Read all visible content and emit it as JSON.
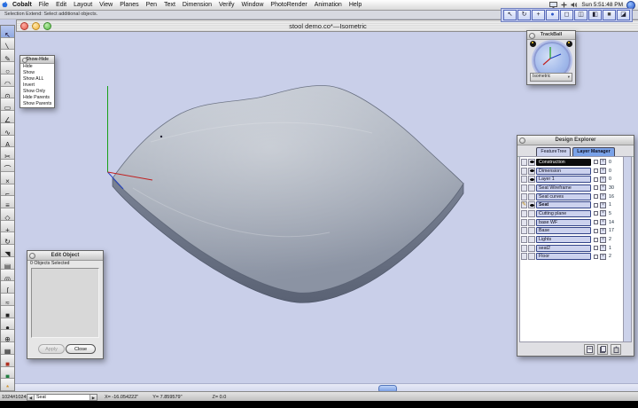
{
  "menu_bar": {
    "app_name": "Cobalt",
    "menus": [
      "File",
      "Edit",
      "Layout",
      "View",
      "Planes",
      "Pen",
      "Text",
      "Dimension",
      "Verify",
      "Window",
      "PhotoRender",
      "Animation",
      "Help"
    ],
    "extras": {
      "icons": [
        "displays-icon",
        "plus-icon",
        "volume-icon",
        "app-switcher-icon"
      ],
      "clock": "Sun 5:51:48 PM"
    }
  },
  "message_line": "Selection Extend: Select additional objects.",
  "window": {
    "title": "stool demo.co*—Isometric"
  },
  "view_toolbar": {
    "buttons": [
      {
        "name": "select-mode-button",
        "glyph": "↖"
      },
      {
        "name": "orbit-view-button",
        "glyph": "↻"
      },
      {
        "name": "pan-view-button",
        "glyph": "+"
      },
      {
        "name": "zoom-sphere-button",
        "glyph": "●",
        "color": "#2a56c8"
      },
      {
        "name": "wireframe-view-button",
        "glyph": "◻"
      },
      {
        "name": "hiddenline-view-button",
        "glyph": "◫"
      },
      {
        "name": "shaded-view-button",
        "glyph": "◧"
      },
      {
        "name": "rendered-view-button",
        "glyph": "■",
        "color": "#444444"
      },
      {
        "name": "view-options-button",
        "glyph": "◪"
      }
    ]
  },
  "tool_palette": {
    "tools": [
      {
        "name": "select-arrow-tool",
        "glyph": "↖",
        "selected": true
      },
      {
        "name": "line-tool",
        "glyph": "╲"
      },
      {
        "name": "pen-tool",
        "glyph": "✎"
      },
      {
        "name": "circle-tool",
        "glyph": "○"
      },
      {
        "name": "arc-tool",
        "glyph": "◠"
      },
      {
        "name": "ellipse-tool",
        "glyph": "⊙"
      },
      {
        "name": "rectangle-tool",
        "glyph": "▭"
      },
      {
        "name": "polyline-tool",
        "glyph": "∠"
      },
      {
        "name": "spline-tool",
        "glyph": "∿"
      },
      {
        "name": "text-tool",
        "glyph": "A"
      },
      {
        "name": "knife-tool",
        "glyph": "✂"
      },
      {
        "name": "trim-tool",
        "glyph": "⌒"
      },
      {
        "name": "delete-tool",
        "glyph": "×"
      },
      {
        "name": "fillet-tool",
        "glyph": "⌐"
      },
      {
        "name": "offset-tool",
        "glyph": "≡"
      },
      {
        "name": "mirror-tool",
        "glyph": "◇"
      },
      {
        "name": "move-tool",
        "glyph": "+"
      },
      {
        "name": "rotate-tool",
        "glyph": "↻"
      },
      {
        "name": "scale-tool",
        "glyph": "◥"
      },
      {
        "name": "extrude-tool",
        "glyph": "▤"
      },
      {
        "name": "revolve-tool",
        "glyph": "◎"
      },
      {
        "name": "sweep-tool",
        "glyph": "∫"
      },
      {
        "name": "loft-tool",
        "glyph": "≈"
      },
      {
        "name": "solid-box-tool",
        "glyph": "■"
      },
      {
        "name": "sphere-tool",
        "glyph": "●"
      },
      {
        "name": "boolean-tool",
        "glyph": "⊕"
      },
      {
        "name": "surface-tool",
        "glyph": "▦"
      },
      {
        "name": "render-tool",
        "glyph": "■",
        "color": "#b03020"
      },
      {
        "name": "shade-tool",
        "glyph": "■",
        "color": "#208040"
      },
      {
        "name": "lights-tool",
        "glyph": "*",
        "color": "#d08000"
      }
    ]
  },
  "show_hide_menu": {
    "title": "Show-Hide",
    "items": [
      "Hide",
      "Show",
      "Show ALL",
      "Invert",
      "Show Only",
      "Hide Parents",
      "Show Parents"
    ]
  },
  "trackball": {
    "title": "TrackBall",
    "view_selector": "Isometric"
  },
  "design_explorer": {
    "title": "Design Explorer",
    "tabs": [
      {
        "label": "FeatureTree",
        "active": false
      },
      {
        "label": "Layer Manager",
        "active": true
      }
    ],
    "layers": [
      {
        "name": "Construction",
        "count": "0",
        "eye": true,
        "selected": true
      },
      {
        "name": "Dimension",
        "count": "0",
        "eye": true
      },
      {
        "name": "Layer 1",
        "count": "0",
        "eye": true
      },
      {
        "name": "Seat Wireframe",
        "count": "30"
      },
      {
        "name": "Seat curves",
        "count": "16"
      },
      {
        "name": "Seat",
        "count": "1",
        "eye": true,
        "pencil": true,
        "bold": true
      },
      {
        "name": "Cutting plane",
        "count": "5"
      },
      {
        "name": "base WF",
        "count": "14"
      },
      {
        "name": "Base",
        "count": "17"
      },
      {
        "name": "Lights",
        "count": "2"
      },
      {
        "name": "seat2",
        "count": "1"
      },
      {
        "name": "Floor",
        "count": "2"
      }
    ],
    "bottom_buttons": [
      "new-layer-button",
      "copy-layer-button",
      "delete-layer-button"
    ]
  },
  "edit_object": {
    "title": "Edit Object",
    "status": "0 Objects Selected",
    "apply_label": "Apply",
    "close_label": "Close"
  },
  "status_bar": {
    "scale": "1024#1024",
    "layer_selector": "Seat",
    "x_label": "X=",
    "x_value": "-16.054222\"",
    "y_label": "Y=",
    "y_value": "7.859579\"",
    "z_label": "Z=",
    "z_value": "0.0"
  },
  "colors": {
    "viewport_bg": "#c9cfe9",
    "model_gray": "#9aa2b0",
    "axis_red": "#c02020",
    "axis_green": "#18a018",
    "axis_blue": "#2040c0",
    "selection_blue": "#7aa2e8"
  }
}
